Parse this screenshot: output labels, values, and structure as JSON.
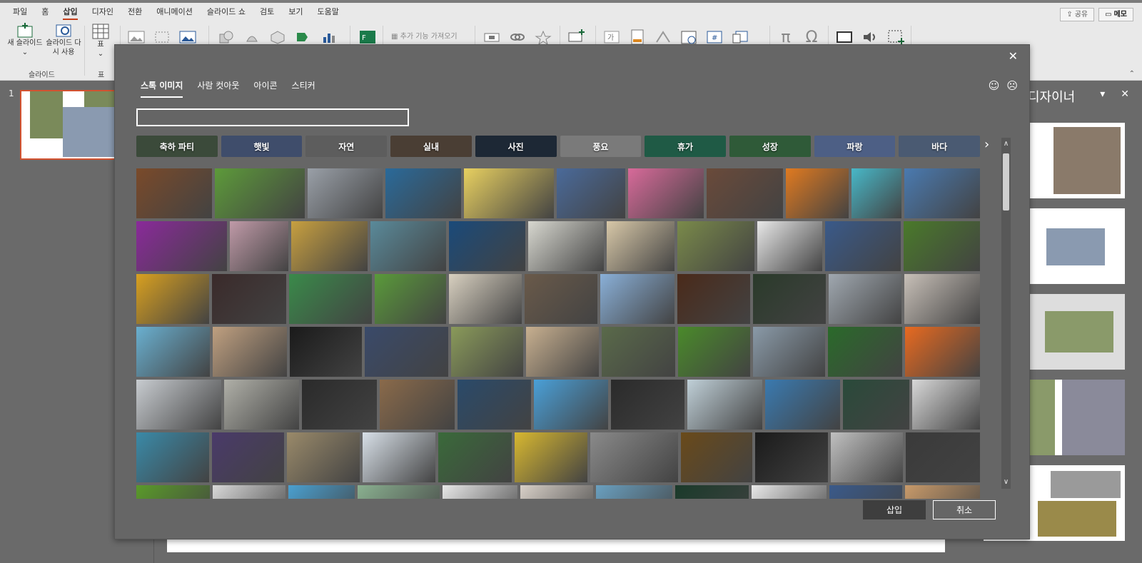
{
  "menu": {
    "tabs": [
      "파일",
      "홈",
      "삽입",
      "디자인",
      "전환",
      "애니메이션",
      "슬라이드 쇼",
      "검토",
      "보기",
      "도움말"
    ],
    "active_index": 2,
    "share_label": "공유",
    "memo_label": "메모"
  },
  "ribbon": {
    "new_slide_label": "새 슬라이드",
    "reuse_slide_label": "슬라이드 다시 사용",
    "table_label": "표",
    "group_slides": "슬라이드",
    "group_table": "표",
    "addons_label": "추가 기능 가져오기"
  },
  "slide_pane": {
    "slide_number": "1"
  },
  "designer": {
    "title": "디자이너"
  },
  "dialog": {
    "tabs": [
      "스톡 이미지",
      "사람 컷아웃",
      "아이콘",
      "스티커"
    ],
    "active_tab": 0,
    "search_value": "",
    "search_placeholder": "",
    "categories": [
      {
        "label": "축하 파티",
        "color": "#3b4a3a"
      },
      {
        "label": "햇빛",
        "color": "#3f4d6b"
      },
      {
        "label": "자연",
        "color": "#5d5d5d"
      },
      {
        "label": "실내",
        "color": "#4a3e34"
      },
      {
        "label": "사진",
        "color": "#1d2835"
      },
      {
        "label": "풍요",
        "color": "#7a7a7a"
      },
      {
        "label": "휴가",
        "color": "#1f5a45"
      },
      {
        "label": "성장",
        "color": "#2f5a38"
      },
      {
        "label": "파랑",
        "color": "#4d5f85"
      },
      {
        "label": "바다",
        "color": "#4a5a72"
      }
    ],
    "insert_label": "삽입",
    "cancel_label": "취소"
  },
  "image_grid": [
    [
      "#7a4a2a",
      "#5d9a3a",
      "#9aa0a8",
      "#2a6a9a",
      "#e8d060",
      "#4a6a9a",
      "#d86a9a",
      "#6a4a3a",
      "#e07a20",
      "#48b8c8",
      "#4a7ab0"
    ],
    [
      "#8a2a9a",
      "#c09aa8",
      "#c8a040",
      "#5a8a9a",
      "#1a4a7a",
      "#d8d8d0",
      "#d8c8a8",
      "#7a8a4a",
      "#e8e8e8",
      "#3a5a8a",
      "#4a7a2a"
    ],
    [
      "#d8a020",
      "#3a2a2a",
      "#3a8a4a",
      "#5a9a3a",
      "#d8d0c0",
      "#6a5a4a",
      "#8ab0d8",
      "#4a2a1a",
      "#2a3a2a",
      "#a0a8b0",
      "#c8c0b8"
    ],
    [
      "#6ab0d0",
      "#c0a080",
      "#1a1a1a",
      "#3a4a6a",
      "#8a9a5a",
      "#c8b090",
      "#5a6a4a",
      "#4a8a2a",
      "#8a9aa8",
      "#2a6a2a",
      "#e86a20"
    ],
    [
      "#c8ccd0",
      "#b0b0a8",
      "#2a2a2a",
      "#8a6a4a",
      "#2a4a6a",
      "#4aa0d8",
      "#2a2a2a",
      "#c0d0d8",
      "#3a7ab0",
      "#2a4a3a",
      "#d8d8d8"
    ],
    [
      "#3a8aa8",
      "#4a3a6a",
      "#9a8a6a",
      "#d8e0e8",
      "#3a6a3a",
      "#d8b830",
      "#8a8a8a",
      "#6a4a1a",
      "#1a1a1a",
      "#c0c0c0",
      "#3a3a3a"
    ],
    [
      "#5a9a2a",
      "#d8d8d8",
      "#4aa0d0",
      "#8ab090",
      "#e8e8e8",
      "#d8d0c8",
      "#6aa0c0",
      "#1a3a2a",
      "#e8e8e8",
      "#3a5a8a",
      "#c89a6a"
    ]
  ]
}
